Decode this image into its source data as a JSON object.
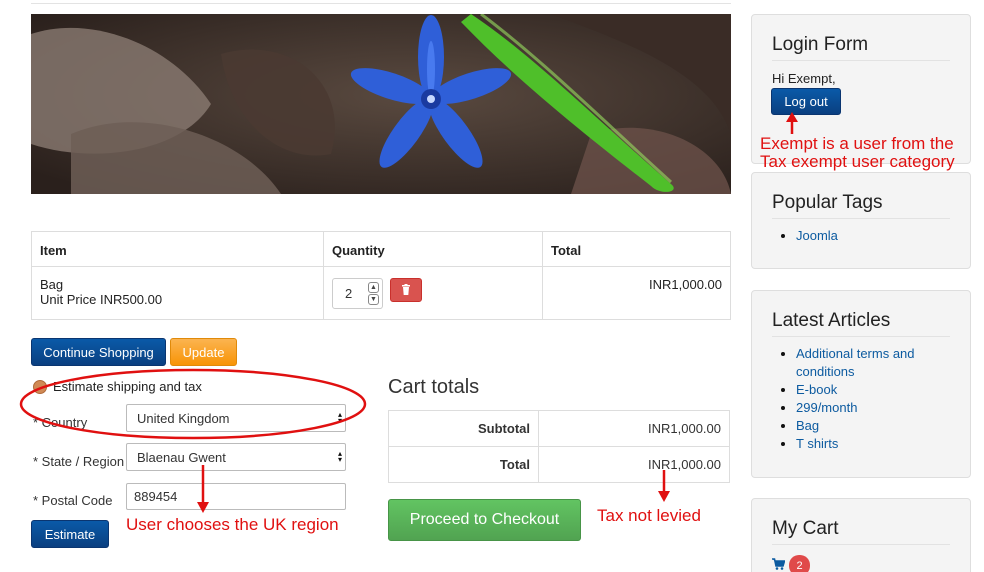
{
  "cart": {
    "headers": {
      "item": "Item",
      "quantity": "Quantity",
      "total": "Total"
    },
    "rows": [
      {
        "name": "Bag",
        "unit_price": "Unit Price INR500.00",
        "qty": "2",
        "total": "INR1,000.00"
      }
    ]
  },
  "buttons": {
    "continue": "Continue Shopping",
    "update": "Update",
    "estimate": "Estimate",
    "checkout": "Proceed to Checkout",
    "logout": "Log out"
  },
  "estimate": {
    "heading": "Estimate shipping and tax",
    "country_label": "* Country",
    "country_value": "United Kingdom",
    "state_label": "* State / Region",
    "state_value": "Blaenau Gwent",
    "postal_label": "* Postal Code",
    "postal_value": "889454"
  },
  "totals": {
    "title": "Cart totals",
    "subtotal_label": "Subtotal",
    "subtotal_value": "INR1,000.00",
    "total_label": "Total",
    "total_value": "INR1,000.00"
  },
  "sidebar": {
    "login_title": "Login Form",
    "greeting": "Hi Exempt,",
    "tags_title": "Popular Tags",
    "tags": [
      "Joomla"
    ],
    "articles_title": "Latest Articles",
    "articles": [
      "Additional terms and conditions",
      "E-book",
      "299/month",
      "Bag",
      "T shirts"
    ],
    "mycart_title": "My Cart",
    "cart_count": "2"
  },
  "annotations": {
    "exempt_line1": "Exempt is a user from the",
    "exempt_line2": "Tax exempt user category",
    "uk_region": "User chooses the UK region",
    "tax": "Tax not levied"
  },
  "colors": {
    "primary": "#0a4a90",
    "warning": "#f89406",
    "success": "#51a351",
    "danger": "#d9534f",
    "annotation": "#e01010",
    "link": "#0d5ba0"
  },
  "icons": {
    "delete": "trash-icon",
    "cart": "shopping-cart-icon",
    "spinner": "stepper-arrows-icon"
  }
}
